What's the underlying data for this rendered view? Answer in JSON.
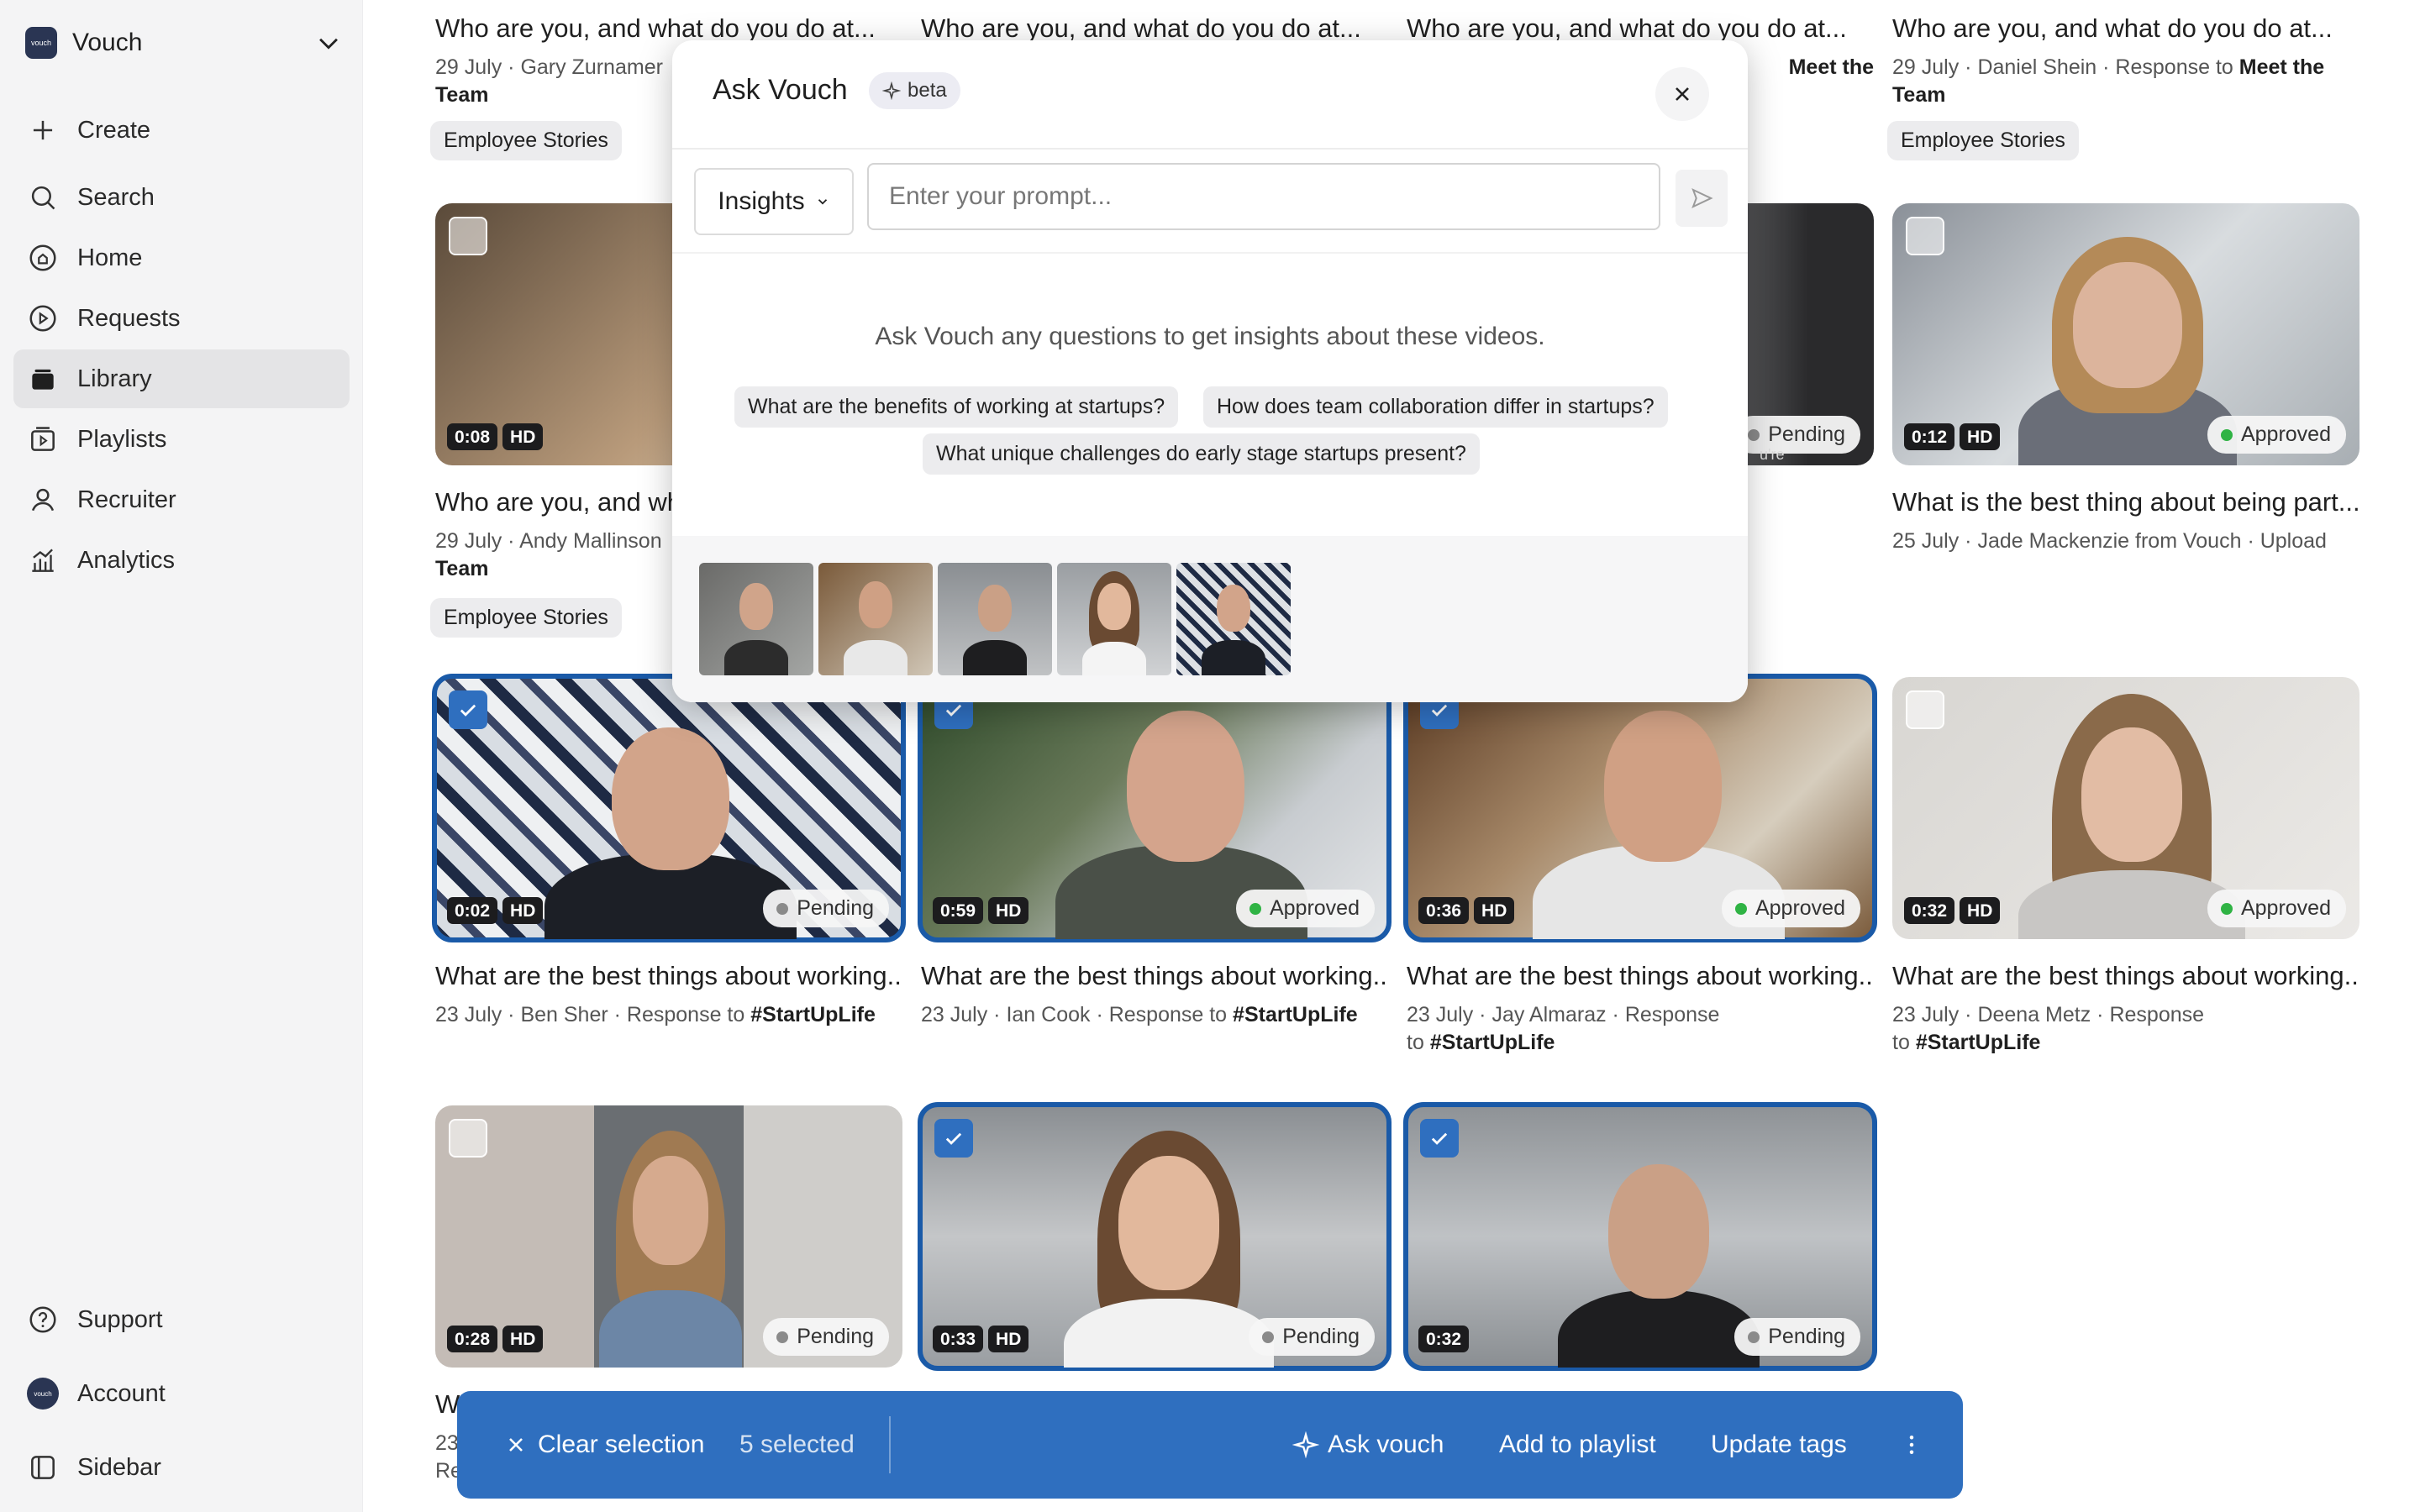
{
  "sidebar": {
    "workspace": "Vouch",
    "logo_text": "vouch",
    "items": [
      {
        "label": "Create",
        "icon": "plus-icon"
      },
      {
        "label": "Search",
        "icon": "search-icon"
      },
      {
        "label": "Home",
        "icon": "home-icon"
      },
      {
        "label": "Requests",
        "icon": "requests-icon"
      },
      {
        "label": "Library",
        "icon": "library-icon"
      },
      {
        "label": "Playlists",
        "icon": "playlists-icon"
      },
      {
        "label": "Recruiter",
        "icon": "user-icon"
      },
      {
        "label": "Analytics",
        "icon": "analytics-icon"
      }
    ],
    "bottom": [
      {
        "label": "Support",
        "icon": "help-icon"
      },
      {
        "label": "Account",
        "icon": "account-icon"
      },
      {
        "label": "Sidebar",
        "icon": "sidebar-icon"
      }
    ]
  },
  "top_row": [
    {
      "title": "Who are you, and what do you do at...",
      "date": "29 July",
      "author": "Gary Zurnamer",
      "cont": "Team",
      "tag": "Employee Stories"
    },
    {
      "title": "Who are you, and what do you do at..."
    },
    {
      "title": "Who are you, and what do you do at...",
      "tail": "Meet the"
    },
    {
      "title": "Who are you, and what do you do at...",
      "date": "29 July",
      "author": "Daniel Shein",
      "resp": "Response to",
      "ref": "Meet the",
      "cont": "Team",
      "tag": "Employee Stories"
    }
  ],
  "row2": [
    {
      "duration": "0:08",
      "hd": "HD",
      "title": "Who are you, and wh",
      "date": "29 July",
      "author": "Andy Mallinson",
      "cont": "Team",
      "tag": "Employee Stories"
    },
    {
      "status": "Pending",
      "label": "u're"
    },
    {
      "duration": "0:12",
      "hd": "HD",
      "status": "Approved",
      "title": "What is the best thing about being part...",
      "date": "25 July",
      "author": "Jade Mackenzie from Vouch",
      "source": "Upload"
    }
  ],
  "row3": [
    {
      "duration": "0:02",
      "hd": "HD",
      "status": "Pending",
      "title": "What are the best things about working...",
      "date": "23 July",
      "author": "Ben Sher",
      "resp": "Response to",
      "ref": "#StartUpLife"
    },
    {
      "duration": "0:59",
      "hd": "HD",
      "status": "Approved",
      "title": "What are the best things about working...",
      "date": "23 July",
      "author": "Ian Cook",
      "resp": "Response to",
      "ref": "#StartUpLife"
    },
    {
      "duration": "0:36",
      "hd": "HD",
      "status": "Approved",
      "title": "What are the best things about working...",
      "date": "23 July",
      "author": "Jay Almaraz",
      "resp": "Response",
      "to": "to",
      "ref": "#StartUpLife"
    },
    {
      "duration": "0:32",
      "hd": "HD",
      "status": "Approved",
      "title": "What are the best things about working...",
      "date": "23 July",
      "author": "Deena Metz",
      "resp": "Response",
      "to": "to",
      "ref": "#StartUpLife"
    }
  ],
  "row4": [
    {
      "duration": "0:28",
      "hd": "HD",
      "status": "Pending",
      "title": "Wi",
      "date": "23",
      "cont": "Re"
    },
    {
      "duration": "0:33",
      "hd": "HD",
      "status": "Pending"
    },
    {
      "duration": "0:32",
      "status": "Pending"
    }
  ],
  "modal": {
    "title": "Ask Vouch",
    "badge": "beta",
    "mode": "Insights",
    "placeholder": "Enter your prompt...",
    "hint": "Ask Vouch any questions to get insights about these videos.",
    "suggestions": [
      "What are the benefits of working at startups?",
      "How does team collaboration differ in startups?",
      "What unique challenges do early stage startups present?"
    ]
  },
  "actionbar": {
    "clear": "Clear selection",
    "count": "5 selected",
    "ask": "Ask vouch",
    "playlist": "Add to playlist",
    "tags": "Update tags"
  },
  "colors": {
    "accent": "#2f6fbf",
    "selected_outline": "#1a5aa8",
    "approved": "#2fb344",
    "pending": "#8a8a8a"
  }
}
